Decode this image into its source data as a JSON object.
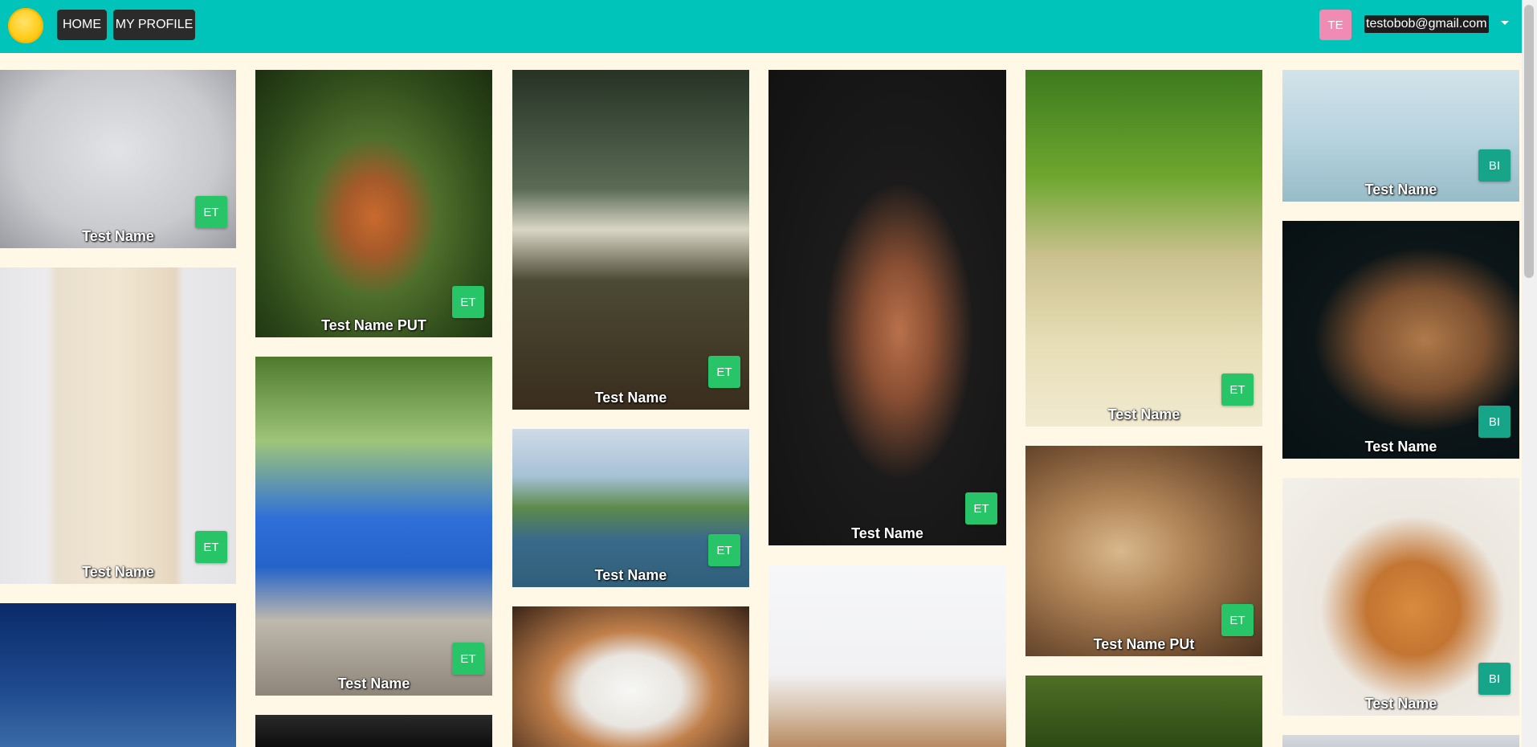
{
  "nav": {
    "home_label": "HOME",
    "profile_label": "MY PROFILE"
  },
  "user": {
    "initials": "TE",
    "email": "testobob@gmail.com"
  },
  "colors": {
    "header": "#00c4b9",
    "page_background": "#fff8e7",
    "badge_et": "#27c468",
    "badge_bi": "#17a589",
    "user_avatar": "#f08bb4"
  },
  "cards": [
    {
      "caption": "Test Name",
      "badge": "ET",
      "image": "leaf-on-snow"
    },
    {
      "caption": "Test Name",
      "badge": "ET",
      "image": "white-staircase"
    },
    {
      "caption": "",
      "badge": "",
      "image": "pine-trees-night-sky"
    },
    {
      "caption": "Test Name PUT",
      "badge": "ET",
      "image": "red-fox"
    },
    {
      "caption": "Test Name",
      "badge": "ET",
      "image": "blue-dinosaur-sculpture"
    },
    {
      "caption": "",
      "badge": "",
      "image": "black-white-photo"
    },
    {
      "caption": "Test Name",
      "badge": "ET",
      "image": "forest-sunset"
    },
    {
      "caption": "Test Name",
      "badge": "ET",
      "image": "lake-island-leaves"
    },
    {
      "caption": "",
      "badge": "",
      "image": "white-orange-cat"
    },
    {
      "caption": "Test Name",
      "badge": "ET",
      "image": "sphynx-cat"
    },
    {
      "caption": "",
      "badge": "",
      "image": "kittens"
    },
    {
      "caption": "Test Name",
      "badge": "ET",
      "image": "grass-field"
    },
    {
      "caption": "Test Name PUt",
      "badge": "ET",
      "image": "lion"
    },
    {
      "caption": "",
      "badge": "",
      "image": "forest-trees"
    },
    {
      "caption": "Test Name",
      "badge": "BI",
      "image": "blue-towers"
    },
    {
      "caption": "Test Name",
      "badge": "BI",
      "image": "giraffe"
    },
    {
      "caption": "Test Name",
      "badge": "BI",
      "image": "orange-cat-stretching"
    },
    {
      "caption": "",
      "badge": "",
      "image": "grey-photo"
    }
  ]
}
